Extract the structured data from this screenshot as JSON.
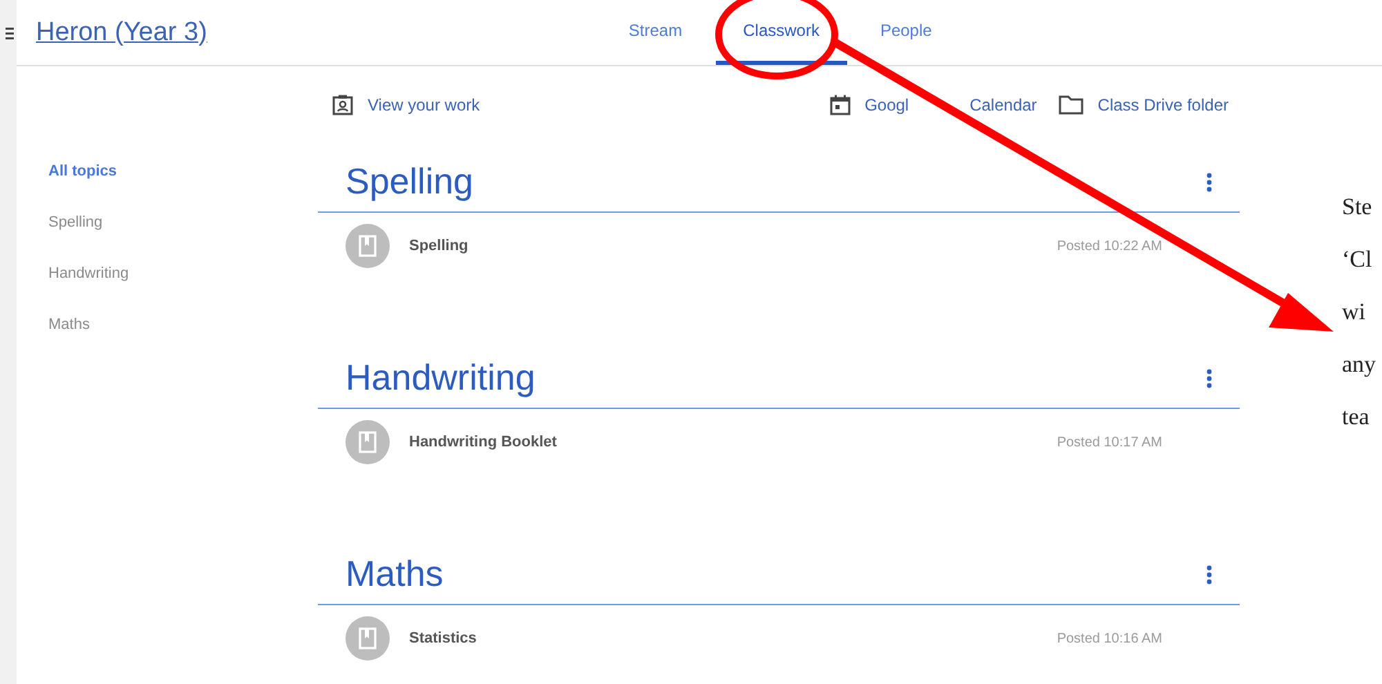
{
  "header": {
    "title": "Heron (Year 3)",
    "tabs": [
      {
        "label": "Stream",
        "selected": false
      },
      {
        "label": "Classwork",
        "selected": true
      },
      {
        "label": "People",
        "selected": false
      }
    ]
  },
  "toolbar": {
    "view_work": "View your work",
    "calendar": [
      "Googl",
      "Calendar"
    ],
    "drive": "Class Drive folder"
  },
  "sidebar": {
    "items": [
      {
        "label": "All topics",
        "selected": true
      },
      {
        "label": "Spelling",
        "selected": false
      },
      {
        "label": "Handwriting",
        "selected": false
      },
      {
        "label": "Maths",
        "selected": false
      }
    ]
  },
  "topics": [
    {
      "title": "Spelling",
      "items": [
        {
          "title": "Spelling",
          "posted": "Posted 10:22 AM"
        }
      ]
    },
    {
      "title": "Handwriting",
      "items": [
        {
          "title": "Handwriting Booklet",
          "posted": "Posted 10:17 AM"
        }
      ]
    },
    {
      "title": "Maths",
      "items": [
        {
          "title": "Statistics",
          "posted": "Posted 10:16 AM"
        }
      ]
    }
  ],
  "annotation": {
    "lines": [
      "Ste",
      "‘Cl",
      "wi",
      "any",
      "tea"
    ]
  }
}
